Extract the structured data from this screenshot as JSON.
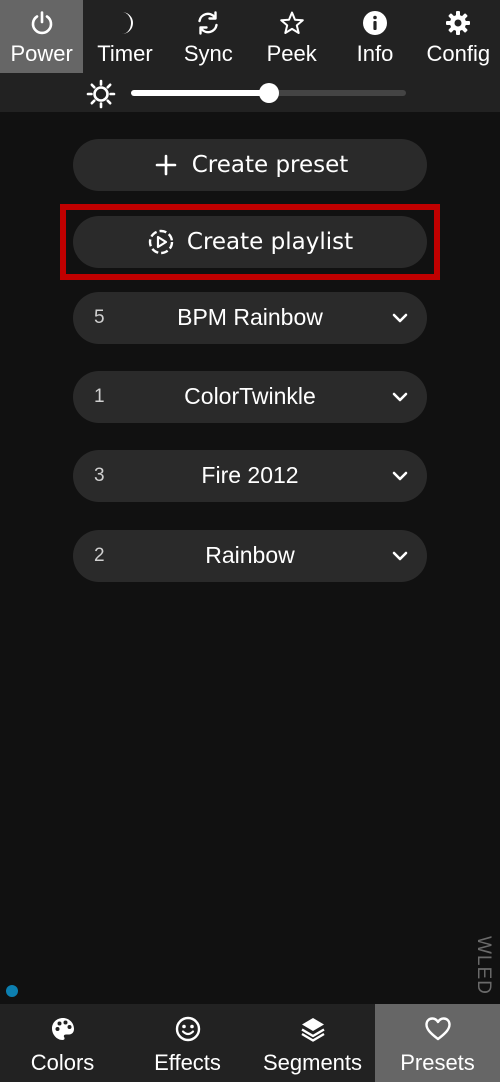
{
  "top_nav": {
    "items": [
      {
        "label": "Power",
        "icon": "power-icon",
        "active": true
      },
      {
        "label": "Timer",
        "icon": "moon-icon",
        "active": false
      },
      {
        "label": "Sync",
        "icon": "sync-icon",
        "active": false
      },
      {
        "label": "Peek",
        "icon": "star-icon",
        "active": false
      },
      {
        "label": "Info",
        "icon": "info-icon",
        "active": false
      },
      {
        "label": "Config",
        "icon": "gear-icon",
        "active": false
      }
    ]
  },
  "brightness": {
    "icon": "brightness-icon",
    "value_fraction": 0.5
  },
  "actions": {
    "create_preset": {
      "label": "Create preset",
      "icon": "plus-icon"
    },
    "create_playlist": {
      "label": "Create playlist",
      "icon": "playlist-icon",
      "highlighted": true
    }
  },
  "presets": [
    {
      "id": "5",
      "name": "BPM Rainbow"
    },
    {
      "id": "1",
      "name": "ColorTwinkle"
    },
    {
      "id": "3",
      "name": "Fire 2012"
    },
    {
      "id": "2",
      "name": "Rainbow"
    }
  ],
  "watermark": "WLED",
  "bottom_nav": {
    "items": [
      {
        "label": "Colors",
        "icon": "palette-icon",
        "active": false
      },
      {
        "label": "Effects",
        "icon": "smiley-icon",
        "active": false
      },
      {
        "label": "Segments",
        "icon": "layers-icon",
        "active": false
      },
      {
        "label": "Presets",
        "icon": "heart-icon",
        "active": true
      }
    ]
  },
  "colors": {
    "background": "#111111",
    "bar": "#222222",
    "active_tab": "#666666",
    "pill": "#2a2a2a",
    "highlight_border": "#c00000",
    "connection_dot": "#0c7fb0"
  }
}
